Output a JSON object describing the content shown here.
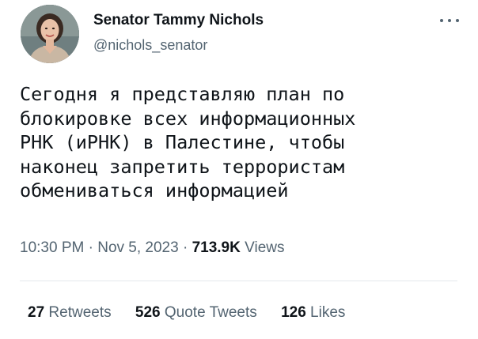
{
  "author": {
    "name": "Senator Tammy Nichols",
    "handle": "@nichols_senator"
  },
  "tweet": {
    "text": "Сегодня я представляю план по\nблокировке всех информационных\nРНК (иРНК) в Палестине, чтобы\nнаконец запретить террористам\nобмениваться информацией"
  },
  "meta": {
    "time": "10:30 PM",
    "date": "Nov 5, 2023",
    "separator": "·",
    "views_count": "713.9K",
    "views_label": "Views"
  },
  "stats": {
    "retweets_count": "27",
    "retweets_label": "Retweets",
    "quotes_count": "526",
    "quotes_label": "Quote Tweets",
    "likes_count": "126",
    "likes_label": "Likes"
  },
  "icons": {
    "more": "more-options-icon",
    "avatar": "profile-photo"
  },
  "colors": {
    "text": "#0f1419",
    "secondary": "#536471",
    "divider": "#e4e8eb"
  }
}
